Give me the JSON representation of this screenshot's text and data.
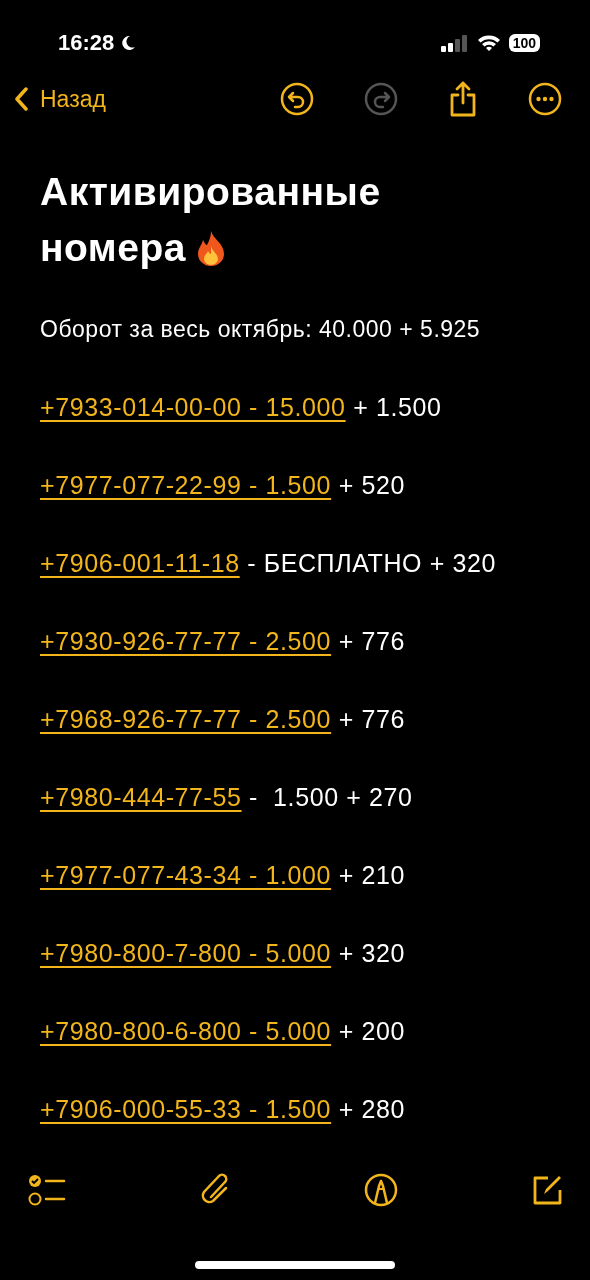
{
  "status_bar": {
    "time": "16:28",
    "battery": "100"
  },
  "nav": {
    "back": "Назад",
    "undo_disabled": false,
    "redo_disabled": true
  },
  "note": {
    "title_lines": [
      "Активированные",
      "номера"
    ],
    "summary": "Оборот за весь октябрь: 40.000 + 5.925",
    "entries": [
      {
        "link": "+7933-014-00-00 - 15.000",
        "rest": " + 1.500"
      },
      {
        "link": "+7977-077-22-99 - 1.500",
        "rest": " + 520"
      },
      {
        "link": "+7906-001-11-18",
        "rest": " - БЕСПЛАТНО + 320"
      },
      {
        "link": "+7930-926-77-77 - 2.500",
        "rest": " + 776"
      },
      {
        "link": "+7968-926-77-77 - 2.500",
        "rest": " + 776"
      },
      {
        "link": "+7980-444-77-55",
        "rest": " -  1.500 + 270"
      },
      {
        "link": "+7977-077-43-34 - 1.000",
        "rest": " + 210"
      },
      {
        "link": "+7980-800-7-800 - 5.000",
        "rest": " + 320"
      },
      {
        "link": "+7980-800-6-800 - 5.000",
        "rest": " + 200"
      },
      {
        "link": "+7906-000-55-33 - 1.500",
        "rest": " + 280"
      }
    ]
  }
}
